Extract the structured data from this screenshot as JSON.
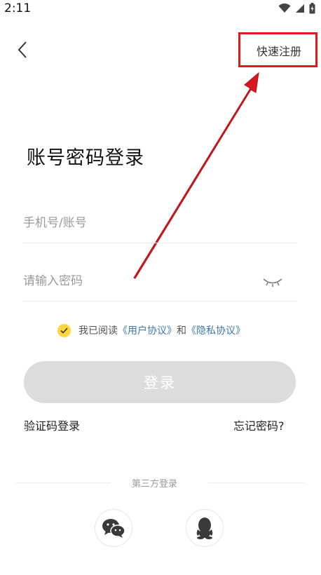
{
  "status_bar": {
    "time": "2:11"
  },
  "header": {
    "register_label": "快速注册"
  },
  "title": "账号密码登录",
  "form": {
    "phone_placeholder": "手机号/账号",
    "password_placeholder": "请输入密码"
  },
  "agreement": {
    "prefix": "我已阅读",
    "user_agreement": "《用户协议》",
    "conjunction": "和",
    "privacy_policy": "《隐私协议》",
    "checked": true
  },
  "actions": {
    "login_label": "登录",
    "sms_login_label": "验证码登录",
    "forgot_password_label": "忘记密码?"
  },
  "third_party": {
    "label": "第三方登录",
    "providers": [
      "wechat-icon",
      "qq-icon"
    ]
  },
  "colors": {
    "accent_yellow": "#ffd73b",
    "link_blue": "#3f78a8",
    "button_disabled": "#dcdcdc",
    "annotation_red": "#e0191f"
  }
}
